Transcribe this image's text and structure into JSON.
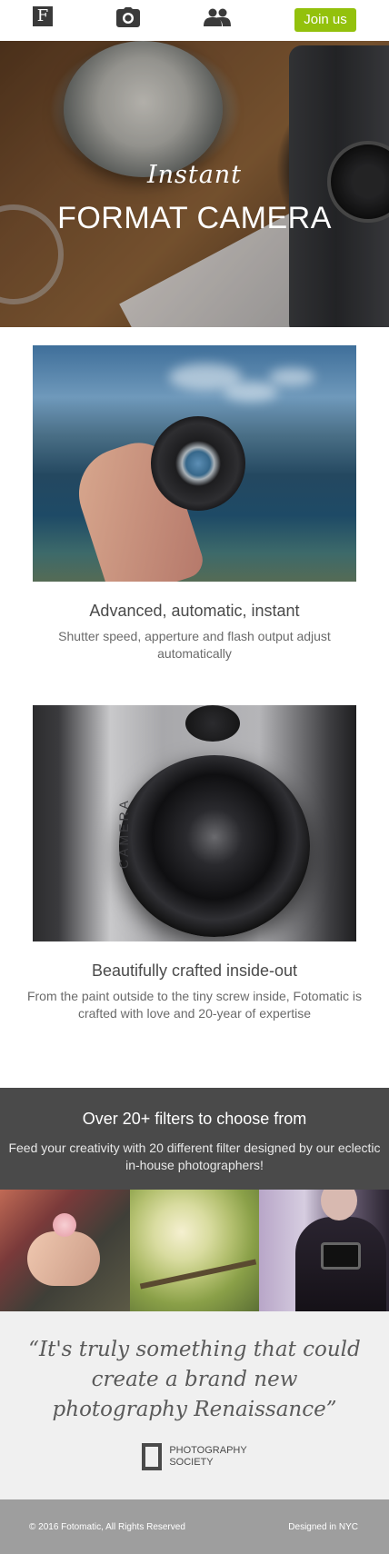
{
  "nav": {
    "logo_letter": "F",
    "icons": [
      "camera-icon",
      "users-icon"
    ],
    "join_label": "Join us",
    "accent_color": "#93c10c"
  },
  "hero": {
    "subtitle": "Instant",
    "title": "FORMAT CAMERA"
  },
  "features": [
    {
      "title": "Advanced, automatic, instant",
      "text": "Shutter speed, apperture and flash output adjust automatically"
    },
    {
      "title": "Beautifully crafted inside-out",
      "text": "From the paint outside to the tiny screw inside, Fotomatic is crafted with love and 20-year of expertise"
    }
  ],
  "feature2_image_text": "CAMERA",
  "filters": {
    "title": "Over 20+ filters to choose from",
    "text": "Feed your creativity with 20 different filter designed by our eclectic in-house photographers!"
  },
  "quote": {
    "text": "“It's truly something that could create a brand new photography Renaissance”",
    "source_line1": "PHOTOGRAPHY",
    "source_line2": "SOCIETY"
  },
  "footer": {
    "copyright": "© 2016 Fotomatic, All Rights Reserved",
    "credit": "Designed in NYC"
  }
}
